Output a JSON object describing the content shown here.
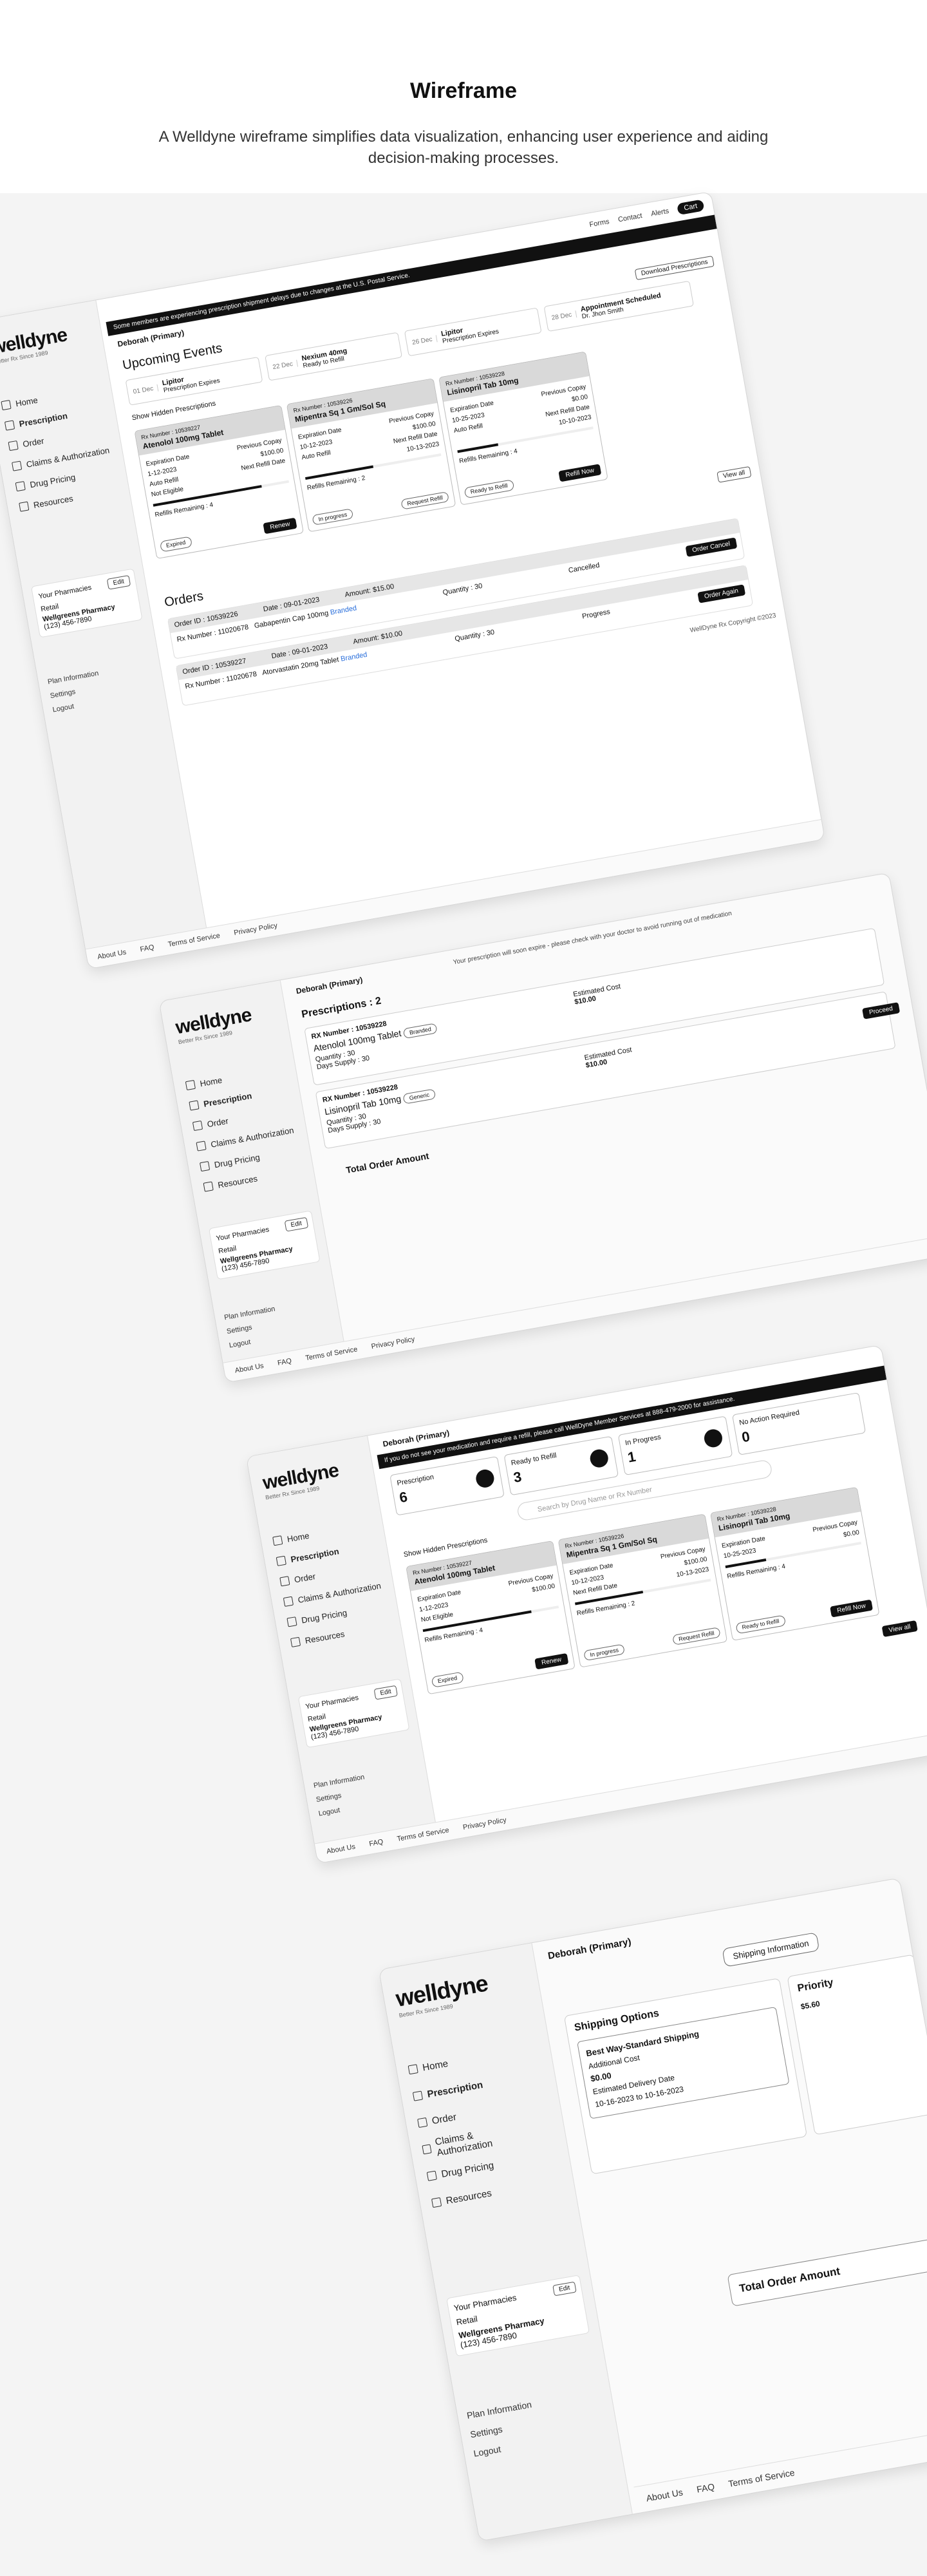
{
  "hero": {
    "title": "Wireframe",
    "subtitle": "A Welldyne wireframe simplifies data visualization, enhancing user experience and aiding decision-making processes."
  },
  "brand": {
    "logo": "welldyne",
    "tagline": "Better Rx Since 1989",
    "copyright": "WellDyne Rx Copyright ©2023"
  },
  "nav": [
    "Home",
    "Prescription",
    "Order",
    "Claims & Authorization",
    "Drug Pricing",
    "Resources"
  ],
  "pharmacy": {
    "title": "Your Pharmacies",
    "edit": "Edit",
    "type": "Retail",
    "name": "Wellgreens Pharmacy",
    "phone": "(123) 456-7890"
  },
  "side_links": [
    "Plan Information",
    "Settings",
    "Logout"
  ],
  "topbar": {
    "forms": "Forms",
    "contact": "Contact",
    "alerts": "Alerts",
    "cart": "Cart"
  },
  "footer": [
    "About Us",
    "FAQ",
    "Terms of Service",
    "Privacy Policy"
  ],
  "dashboard": {
    "user": "Deborah (Primary)",
    "banner": "Some members are experiencing prescription shipment delays due to changes at the U.S. Postal Service.",
    "events_title": "Upcoming Events",
    "download": "Download Prescriptions",
    "events": [
      {
        "day": "01 Dec",
        "title": "Lipitor",
        "sub": "Prescription Expires"
      },
      {
        "day": "22 Dec",
        "title": "Nexium 40mg",
        "sub": "Ready to Refill"
      },
      {
        "day": "26 Dec",
        "title": "Lipitor",
        "sub": "Prescription Expires"
      },
      {
        "day": "28 Dec",
        "title": "Appointment Scheduled",
        "sub": "Dr. Jhon Smith"
      }
    ],
    "show_hidden": "Show Hidden Prescriptions",
    "cards": [
      {
        "rx": "Rx Number : 10539227",
        "drug": "Atenolol 100mg Tablet",
        "exp_label": "Expiration Date",
        "exp": "1-12-2023",
        "copay_label": "Previous Copay",
        "copay": "$100.00",
        "refill_label": "Next Refill Date",
        "refill": "",
        "auto": "Auto Refill",
        "elig": "Not Eligible",
        "remaining": "Refills Remaining : 4",
        "status": "Expired",
        "action": "Renew",
        "fill": 0.8
      },
      {
        "rx": "Rx Number : 10539226",
        "drug": "Mipentra Sq 1 Gm/Sol Sq",
        "exp_label": "Expiration Date",
        "exp": "10-12-2023",
        "copay_label": "Previous Copay",
        "copay": "$100.00",
        "refill_label": "Next Refill Date",
        "refill": "10-13-2023",
        "auto": "Auto Refill",
        "elig": "",
        "remaining": "Refills Remaining : 2",
        "status": "In progress",
        "action": "Request Refill",
        "fill": 0.5
      },
      {
        "rx": "Rx Number : 10539228",
        "drug": "Lisinopril Tab 10mg",
        "exp_label": "Expiration Date",
        "exp": "10-25-2023",
        "copay_label": "Previous Copay",
        "copay": "$0.00",
        "refill_label": "Next Refill Date",
        "refill": "10-10-2023",
        "auto": "Auto Refill",
        "elig": "",
        "remaining": "Refills Remaining : 4",
        "status": "Ready to Refill",
        "action": "Refill Now",
        "fill": 0.3
      }
    ],
    "view_all": "View all",
    "orders_title": "Orders",
    "orders": [
      {
        "id": "Order ID : 10539226",
        "date": "Date : 09-01-2023",
        "rx": "Rx Number : 11020678",
        "drug": "Gabapentin Cap 100mg",
        "tag": "Branded",
        "qty": "Quantity : 30",
        "amount": "Amount: $15.00",
        "state": "Cancelled",
        "action": "Order Cancel"
      },
      {
        "id": "Order ID : 10539227",
        "date": "Date : 09-01-2023",
        "rx": "Rx Number : 11020678",
        "drug": "Atorvastatin 20mg Tablet",
        "tag": "Branded",
        "qty": "Quantity : 30",
        "amount": "Amount: $10.00",
        "state": "Progress",
        "action": "Order Again"
      }
    ]
  },
  "prescriptions": {
    "user": "Deborah (Primary)",
    "title": "Prescriptions : 2",
    "notice": "Your prescription will soon expire - please check with your doctor to avoid running out of medication",
    "items": [
      {
        "rx": "RX Number : 10539228",
        "drug": "Atenolol 100mg Tablet",
        "tag": "Branded",
        "qty": "Quantity : 30",
        "supply": "Days Supply : 30",
        "cost_label": "Estimated Cost",
        "cost": "$10.00"
      },
      {
        "rx": "RX Number : 10539228",
        "drug": "Lisinopril Tab 10mg",
        "tag": "Generic",
        "qty": "Quantity : 30",
        "supply": "Days Supply : 30",
        "cost_label": "Estimated Cost",
        "cost": "$10.00"
      }
    ],
    "total": "Total Order Amount",
    "proceed": "Proceed"
  },
  "rx_list": {
    "user": "Deborah (Primary)",
    "banner": "If you do not see your medication and require a refill, please call WellDyne Member Services at 888-479-2000 for assistance.",
    "stats": [
      {
        "label": "Prescription",
        "value": "6"
      },
      {
        "label": "Ready to Refill",
        "value": "3"
      },
      {
        "label": "In Progress",
        "value": "1"
      },
      {
        "label": "No Action Required",
        "value": "0"
      }
    ],
    "search": "Search by Drug Name or Rx Number",
    "show_hidden": "Show Hidden Prescriptions"
  },
  "shipping": {
    "user": "Deborah (Primary)",
    "step": "Shipping Information",
    "title": "Shipping Options",
    "option": "Best Way-Standard Shipping",
    "cost_label": "Additional Cost",
    "cost": "$0.00",
    "date_label": "Estimated Delivery Date",
    "date": "10-16-2023 to 10-16-2023",
    "option2": "Priority",
    "option2_cost": "$5.60",
    "total": "Total Order Amount"
  }
}
